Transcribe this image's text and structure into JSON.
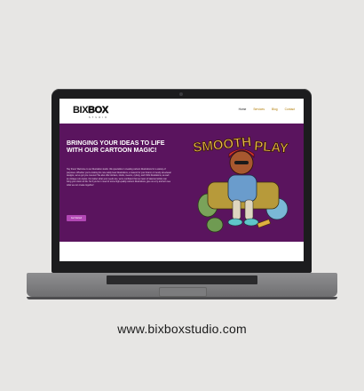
{
  "site": {
    "logo_part1": "BIX",
    "logo_part2": "BOX",
    "logo_sub": "STUDIO"
  },
  "nav": {
    "items": [
      "Home",
      "Services",
      "Blog",
      "Contact"
    ]
  },
  "hero": {
    "title": "BRINGING YOUR IDEAS TO LIFE WITH OUR CARTOON MAGIC!",
    "body": "Hey there! Welcome to our illustration studio. We specialize in creating cartoon illustrations for a variety of purposes. Whether you're looking for cute teddy bear illustrations, a mascot for your brand, or trendy streetwear designs, we've got you covered. We also offer stickers, intuits, meems, cyborg, and Chibi illustrations, as well as vintage retro styles. No matter what your needs are, we're confident that our team of talented artists can bring your vision to life. So if you're in need of some high-quality cartoon illustrations, give us a try and let's see what we can create together!",
    "button": "Get Started",
    "art_text_left": "SMOOTH",
    "art_text_right": "PLAY"
  },
  "caption": {
    "url": "www.bixboxstudio.com"
  },
  "colors": {
    "hero_bg": "#5a145e",
    "button": "#b248b5",
    "nav_link": "#b07a00",
    "art_yellow": "#e9b94a"
  }
}
